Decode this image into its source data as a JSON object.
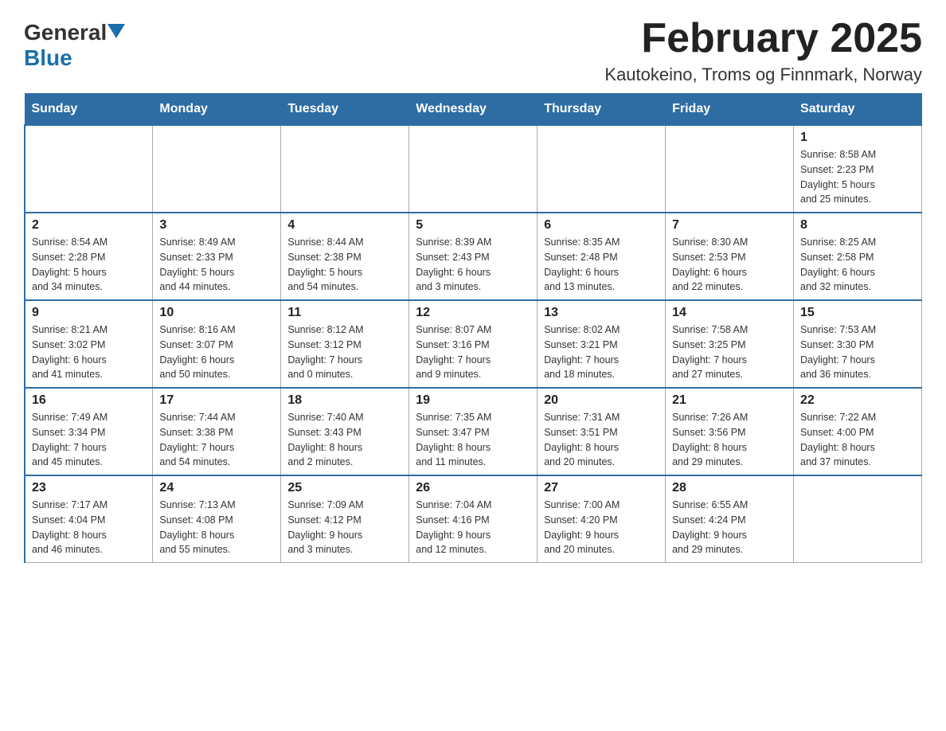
{
  "logo": {
    "general": "General",
    "blue": "Blue"
  },
  "title": "February 2025",
  "subtitle": "Kautokeino, Troms og Finnmark, Norway",
  "days_of_week": [
    "Sunday",
    "Monday",
    "Tuesday",
    "Wednesday",
    "Thursday",
    "Friday",
    "Saturday"
  ],
  "weeks": [
    [
      {
        "day": "",
        "info": ""
      },
      {
        "day": "",
        "info": ""
      },
      {
        "day": "",
        "info": ""
      },
      {
        "day": "",
        "info": ""
      },
      {
        "day": "",
        "info": ""
      },
      {
        "day": "",
        "info": ""
      },
      {
        "day": "1",
        "info": "Sunrise: 8:58 AM\nSunset: 2:23 PM\nDaylight: 5 hours\nand 25 minutes."
      }
    ],
    [
      {
        "day": "2",
        "info": "Sunrise: 8:54 AM\nSunset: 2:28 PM\nDaylight: 5 hours\nand 34 minutes."
      },
      {
        "day": "3",
        "info": "Sunrise: 8:49 AM\nSunset: 2:33 PM\nDaylight: 5 hours\nand 44 minutes."
      },
      {
        "day": "4",
        "info": "Sunrise: 8:44 AM\nSunset: 2:38 PM\nDaylight: 5 hours\nand 54 minutes."
      },
      {
        "day": "5",
        "info": "Sunrise: 8:39 AM\nSunset: 2:43 PM\nDaylight: 6 hours\nand 3 minutes."
      },
      {
        "day": "6",
        "info": "Sunrise: 8:35 AM\nSunset: 2:48 PM\nDaylight: 6 hours\nand 13 minutes."
      },
      {
        "day": "7",
        "info": "Sunrise: 8:30 AM\nSunset: 2:53 PM\nDaylight: 6 hours\nand 22 minutes."
      },
      {
        "day": "8",
        "info": "Sunrise: 8:25 AM\nSunset: 2:58 PM\nDaylight: 6 hours\nand 32 minutes."
      }
    ],
    [
      {
        "day": "9",
        "info": "Sunrise: 8:21 AM\nSunset: 3:02 PM\nDaylight: 6 hours\nand 41 minutes."
      },
      {
        "day": "10",
        "info": "Sunrise: 8:16 AM\nSunset: 3:07 PM\nDaylight: 6 hours\nand 50 minutes."
      },
      {
        "day": "11",
        "info": "Sunrise: 8:12 AM\nSunset: 3:12 PM\nDaylight: 7 hours\nand 0 minutes."
      },
      {
        "day": "12",
        "info": "Sunrise: 8:07 AM\nSunset: 3:16 PM\nDaylight: 7 hours\nand 9 minutes."
      },
      {
        "day": "13",
        "info": "Sunrise: 8:02 AM\nSunset: 3:21 PM\nDaylight: 7 hours\nand 18 minutes."
      },
      {
        "day": "14",
        "info": "Sunrise: 7:58 AM\nSunset: 3:25 PM\nDaylight: 7 hours\nand 27 minutes."
      },
      {
        "day": "15",
        "info": "Sunrise: 7:53 AM\nSunset: 3:30 PM\nDaylight: 7 hours\nand 36 minutes."
      }
    ],
    [
      {
        "day": "16",
        "info": "Sunrise: 7:49 AM\nSunset: 3:34 PM\nDaylight: 7 hours\nand 45 minutes."
      },
      {
        "day": "17",
        "info": "Sunrise: 7:44 AM\nSunset: 3:38 PM\nDaylight: 7 hours\nand 54 minutes."
      },
      {
        "day": "18",
        "info": "Sunrise: 7:40 AM\nSunset: 3:43 PM\nDaylight: 8 hours\nand 2 minutes."
      },
      {
        "day": "19",
        "info": "Sunrise: 7:35 AM\nSunset: 3:47 PM\nDaylight: 8 hours\nand 11 minutes."
      },
      {
        "day": "20",
        "info": "Sunrise: 7:31 AM\nSunset: 3:51 PM\nDaylight: 8 hours\nand 20 minutes."
      },
      {
        "day": "21",
        "info": "Sunrise: 7:26 AM\nSunset: 3:56 PM\nDaylight: 8 hours\nand 29 minutes."
      },
      {
        "day": "22",
        "info": "Sunrise: 7:22 AM\nSunset: 4:00 PM\nDaylight: 8 hours\nand 37 minutes."
      }
    ],
    [
      {
        "day": "23",
        "info": "Sunrise: 7:17 AM\nSunset: 4:04 PM\nDaylight: 8 hours\nand 46 minutes."
      },
      {
        "day": "24",
        "info": "Sunrise: 7:13 AM\nSunset: 4:08 PM\nDaylight: 8 hours\nand 55 minutes."
      },
      {
        "day": "25",
        "info": "Sunrise: 7:09 AM\nSunset: 4:12 PM\nDaylight: 9 hours\nand 3 minutes."
      },
      {
        "day": "26",
        "info": "Sunrise: 7:04 AM\nSunset: 4:16 PM\nDaylight: 9 hours\nand 12 minutes."
      },
      {
        "day": "27",
        "info": "Sunrise: 7:00 AM\nSunset: 4:20 PM\nDaylight: 9 hours\nand 20 minutes."
      },
      {
        "day": "28",
        "info": "Sunrise: 6:55 AM\nSunset: 4:24 PM\nDaylight: 9 hours\nand 29 minutes."
      },
      {
        "day": "",
        "info": ""
      }
    ]
  ]
}
